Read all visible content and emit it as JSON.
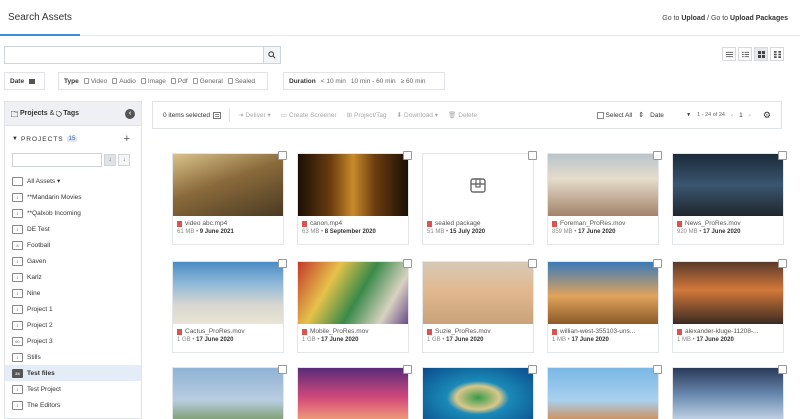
{
  "header": {
    "tab": "Search Assets",
    "goto_prefix": "Go to",
    "upload": "Upload",
    "slash_goto": "/ Go to",
    "upload_packages": "Upload Packages"
  },
  "search": {
    "placeholder": ""
  },
  "filters": {
    "date": "Date",
    "type_label": "Type",
    "types": [
      "Video",
      "Audio",
      "Image",
      "Pdf",
      "General",
      "Sealed"
    ],
    "duration_label": "Duration",
    "durations": [
      "< 10 min",
      "10 min - 60 min",
      "≥ 60 min"
    ]
  },
  "sidebar": {
    "projects_tab": "Projects",
    "amp": "&",
    "tags_tab": "Tags",
    "projects_heading": "PROJECTS",
    "projects_count": "15",
    "items": [
      {
        "icon": "",
        "label": "All Assets ▾"
      },
      {
        "icon": "1",
        "label": "**Mandarin Movies"
      },
      {
        "icon": "1",
        "label": "**Qalxob Incoming"
      },
      {
        "icon": "1",
        "label": "DE Test"
      },
      {
        "icon": "8",
        "label": "Football"
      },
      {
        "icon": "1",
        "label": "Gaven"
      },
      {
        "icon": "1",
        "label": "Karlz"
      },
      {
        "icon": "1",
        "label": "Nine"
      },
      {
        "icon": "1",
        "label": "Project 1"
      },
      {
        "icon": "1",
        "label": "Project 2"
      },
      {
        "icon": "60",
        "label": "Project 3"
      },
      {
        "icon": "1",
        "label": "Stills"
      },
      {
        "icon": "24",
        "label": "Test files",
        "selected": true
      },
      {
        "icon": "1",
        "label": "Test Project"
      },
      {
        "icon": "1",
        "label": "The Editors"
      }
    ]
  },
  "toolbar": {
    "selected": "0 items selected",
    "deliver": "Deliver ▾",
    "create_screener": "Create Screener",
    "project_tag": "Project/Tag",
    "download": "Download ▾",
    "delete": "Delete",
    "select_all": "Select All",
    "sort": "Date",
    "page_range": "1 - 24 of 24",
    "page": "1"
  },
  "assets": [
    {
      "name": "video abc.mp4",
      "size": "61 MB",
      "date": "9 June 2021",
      "thumb": "linear-gradient(160deg,#d9c28a 0%,#8a6a3b 45%,#4a3a22 100%)"
    },
    {
      "name": "canon.mp4",
      "size": "63 MB",
      "date": "8 September 2020",
      "thumb": "linear-gradient(90deg,#1a0f05 0%,#6b3d10 30%,#c98a2a 50%,#6b3d10 70%,#1a0f05 100%)"
    },
    {
      "name": "sealed package",
      "size": "51 MB",
      "date": "15 July 2020",
      "thumb": "sealed"
    },
    {
      "name": "Foreman_ProRes.mov",
      "size": "859 MB",
      "date": "17 June 2020",
      "thumb": "linear-gradient(180deg,#b9c4cc 0%,#e6dccb 40%,#a3836a 100%)"
    },
    {
      "name": "News_ProRes.mov",
      "size": "920 MB",
      "date": "17 June 2020",
      "thumb": "linear-gradient(180deg,#1b2b3a 0%,#3a5670 50%,#20262c 100%)"
    },
    {
      "name": "Cactus_ProRes.mov",
      "size": "1 GB",
      "date": "17 June 2020",
      "thumb": "linear-gradient(180deg,#4a8bc4 0%,#8fb9d9 35%,#d9d7cf 70%,#e8e4d6 100%)"
    },
    {
      "name": "Mobile_ProRes.mov",
      "size": "1 GB",
      "date": "17 June 2020",
      "thumb": "linear-gradient(120deg,#c23a2a 0%,#e6c24a 30%,#3a8a4a 55%,#d8d2c0 80%,#6a4a8a 100%)"
    },
    {
      "name": "Suzie_ProRes.mov",
      "size": "1 GB",
      "date": "17 June 2020",
      "thumb": "linear-gradient(180deg,#d6c9b6 0%,#e2b98f 45%,#c9a27a 100%)"
    },
    {
      "name": "willian-west-355103-uns...",
      "size": "1 MB",
      "date": "17 June 2020",
      "thumb": "linear-gradient(180deg,#3a7ab8 0%,#e0a35a 55%,#8a5a2a 100%)"
    },
    {
      "name": "alexander-kluge-11208-...",
      "size": "1 MB",
      "date": "17 June 2020",
      "thumb": "linear-gradient(180deg,#5a3a2a 0%,#d2783a 45%,#3a2a22 100%)"
    },
    {
      "name": "",
      "size": "",
      "date": "",
      "thumb": "linear-gradient(180deg,#8fb3d6 0%,#b9cde0 60%,#7a9a6a 100%)"
    },
    {
      "name": "",
      "size": "",
      "date": "",
      "thumb": "linear-gradient(180deg,#5a2a7a 0%,#d24a7a 55%,#f2a27a 100%)"
    },
    {
      "name": "",
      "size": "",
      "date": "",
      "thumb": "radial-gradient(ellipse at 50% 55%,#3a9a4a 0%,#d8c88a 28%,#1a8ab8 40%,#0a4a8a 100%)"
    },
    {
      "name": "",
      "size": "",
      "date": "",
      "thumb": "linear-gradient(180deg,#7ab8e6 0%,#a9d0ee 60%,#d28a4a 100%)"
    },
    {
      "name": "",
      "size": "",
      "date": "",
      "thumb": "linear-gradient(180deg,#2a3a5a 0%,#6a8ab0 50%,#c8d8e8 100%)"
    }
  ]
}
